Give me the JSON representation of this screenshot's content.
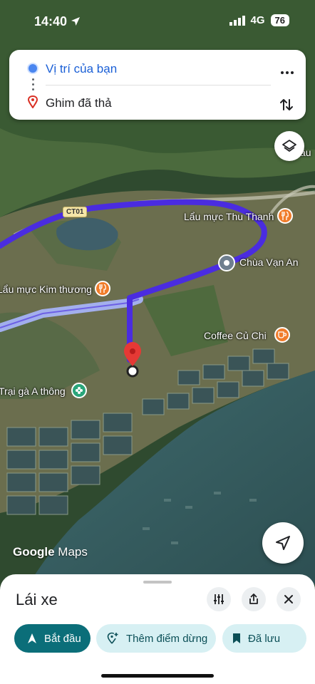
{
  "status_bar": {
    "time": "14:40",
    "network": "4G",
    "battery": "76"
  },
  "directions": {
    "origin": "Vị trí của bạn",
    "destination": "Ghim đã thả"
  },
  "map": {
    "road_label": "CT01",
    "pois": [
      {
        "name": "Lẩu mực Thu Thanh",
        "icon": "restaurant-icon",
        "color": "#f07c2a"
      },
      {
        "name": "Chùa Vạn An",
        "icon": "place-icon",
        "color": "#6f7f8f"
      },
      {
        "name": "Lẩu mực Kim thương",
        "icon": "restaurant-icon",
        "color": "#f07c2a"
      },
      {
        "name": "Coffee Củ Chi",
        "icon": "coffee-icon",
        "color": "#f07c2a"
      },
      {
        "name": "Trại gà A thông",
        "icon": "flower-icon",
        "color": "#2aa57a"
      }
    ],
    "partial_label": "ầu",
    "logo": {
      "brand": "Google",
      "product": "Maps"
    },
    "route_color": "#4a2ce0",
    "pin_color": "#e53935"
  },
  "sheet": {
    "mode_title": "Lái xe",
    "start_label": "Bắt đầu",
    "add_stop_label": "Thêm điểm dừng",
    "saved_label": "Đã lưu"
  },
  "colors": {
    "accent": "#0b6e79",
    "chip_bg": "#d7f0f3",
    "origin_blue": "#4a86f0"
  }
}
